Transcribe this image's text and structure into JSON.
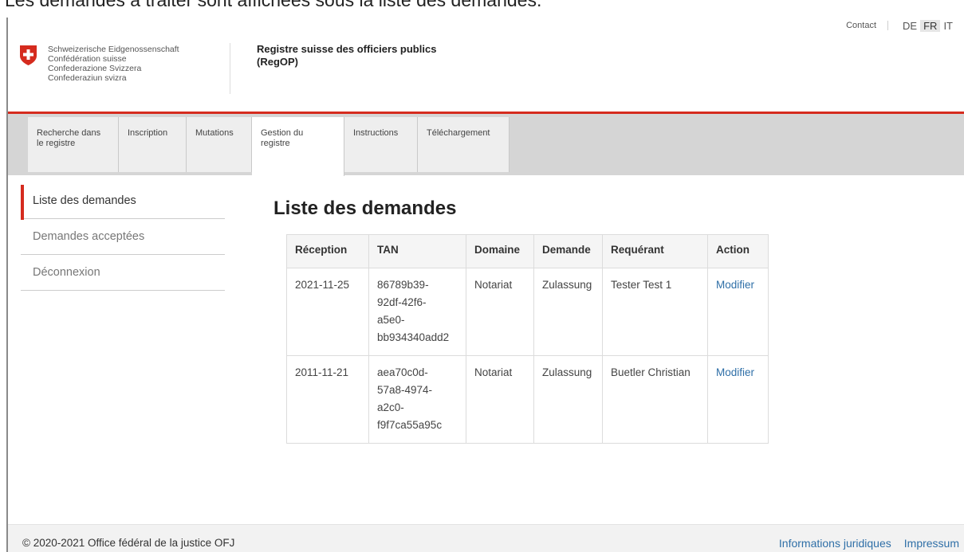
{
  "caption": "Les demandes à traiter sont affichées sous la liste des demandes.",
  "header": {
    "contact": "Contact",
    "languages": [
      {
        "code": "DE"
      },
      {
        "code": "FR"
      },
      {
        "code": "IT"
      }
    ],
    "federation_names": [
      "Schweizerische Eidgenossenschaft",
      "Confédération suisse",
      "Confederazione Svizzera",
      "Confederaziun svizra"
    ],
    "app_title_line1": "Registre suisse des officiers publics",
    "app_title_line2": "(RegOP)"
  },
  "nav": {
    "tabs": [
      {
        "line1": "Recherche dans",
        "line2": "le registre"
      },
      {
        "line1": "Inscription",
        "line2": ""
      },
      {
        "line1": "Mutations",
        "line2": ""
      },
      {
        "line1": "Gestion du",
        "line2": "registre"
      },
      {
        "line1": "Instructions",
        "line2": ""
      },
      {
        "line1": "Téléchargement",
        "line2": ""
      }
    ],
    "active_tab": "Gestion du registre"
  },
  "sidebar": {
    "items": [
      {
        "label": "Liste des demandes"
      },
      {
        "label": "Demandes acceptées"
      },
      {
        "label": "Déconnexion"
      }
    ]
  },
  "main": {
    "title": "Liste des demandes",
    "table": {
      "headers": [
        "Réception",
        "TAN",
        "Domaine",
        "Demande",
        "Requérant",
        "Action"
      ],
      "rows": [
        {
          "reception": "2021-11-25",
          "tan": [
            "86789b39-",
            "92df-42f6-",
            "a5e0-",
            "bb934340add2"
          ],
          "domaine": "Notariat",
          "demande": "Zulassung",
          "requerant": "Tester Test 1",
          "action": "Modifier"
        },
        {
          "reception": "2011-11-21",
          "tan": [
            "aea70c0d-",
            "57a8-4974-",
            "a2c0-",
            "f9f7ca55a95c"
          ],
          "domaine": "Notariat",
          "demande": "Zulassung",
          "requerant": "Buetler Christian",
          "action": "Modifier"
        }
      ]
    }
  },
  "footer": {
    "copyright": "© 2020-2021 Office fédéral de la justice OFJ",
    "links": [
      "Informations juridiques",
      "Impressum"
    ]
  },
  "colors": {
    "swiss_red": "#d52b1e",
    "link_blue": "#2f6fa7",
    "nav_background": "#d5d5d5"
  }
}
